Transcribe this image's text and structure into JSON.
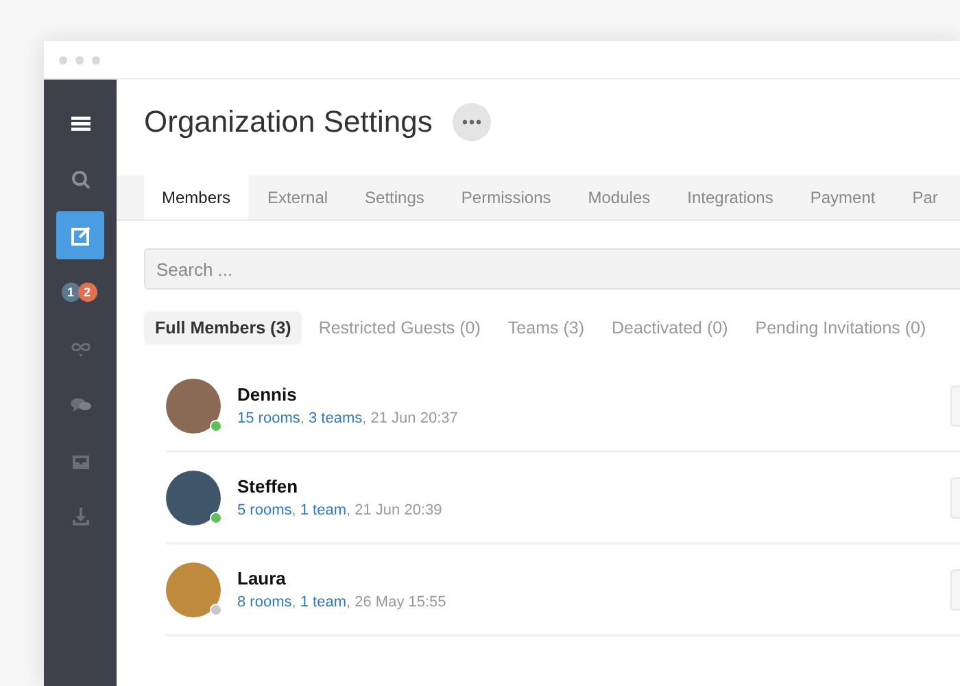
{
  "window": {
    "title": "Organization Settings"
  },
  "sidebar": {
    "items": [
      {
        "kind": "menu",
        "selected": false
      },
      {
        "kind": "search",
        "selected": false
      },
      {
        "kind": "compose",
        "selected": true
      },
      {
        "kind": "badges",
        "selected": false,
        "badges": [
          {
            "label": "1",
            "color": "#5b7a90"
          },
          {
            "label": "2",
            "color": "#e0714f"
          }
        ]
      },
      {
        "kind": "infinity",
        "selected": false
      },
      {
        "kind": "chat",
        "selected": false
      },
      {
        "kind": "inbox",
        "selected": false
      },
      {
        "kind": "download",
        "selected": false
      }
    ]
  },
  "tabs": [
    {
      "label": "Members",
      "selected": true
    },
    {
      "label": "External",
      "selected": false
    },
    {
      "label": "Settings",
      "selected": false
    },
    {
      "label": "Permissions",
      "selected": false
    },
    {
      "label": "Modules",
      "selected": false
    },
    {
      "label": "Integrations",
      "selected": false
    },
    {
      "label": "Payment",
      "selected": false
    },
    {
      "label": "Par",
      "selected": false
    }
  ],
  "search": {
    "placeholder": "Search ..."
  },
  "filters": [
    {
      "label": "Full Members (3)",
      "selected": true
    },
    {
      "label": "Restricted Guests (0)",
      "selected": false
    },
    {
      "label": "Teams (3)",
      "selected": false
    },
    {
      "label": "Deactivated (0)",
      "selected": false
    },
    {
      "label": "Pending Invitations (0)",
      "selected": false
    }
  ],
  "members": [
    {
      "name": "Dennis",
      "online": true,
      "details": [
        {
          "kind": "link",
          "text": "15 rooms"
        },
        {
          "kind": "text",
          "text": ", "
        },
        {
          "kind": "link",
          "text": "3 teams"
        },
        {
          "kind": "text",
          "text": ", "
        },
        {
          "kind": "time",
          "text": "21 Jun 20:37"
        }
      ]
    },
    {
      "name": "Steffen",
      "online": true,
      "details": [
        {
          "kind": "link",
          "text": "5 rooms"
        },
        {
          "kind": "text",
          "text": ", "
        },
        {
          "kind": "link",
          "text": "1 team"
        },
        {
          "kind": "text",
          "text": ", "
        },
        {
          "kind": "time",
          "text": "21 Jun 20:39"
        }
      ]
    },
    {
      "name": "Laura",
      "online": false,
      "details": [
        {
          "kind": "link",
          "text": "8 rooms"
        },
        {
          "kind": "text",
          "text": ", "
        },
        {
          "kind": "link",
          "text": "1 team"
        },
        {
          "kind": "text",
          "text": ", "
        },
        {
          "kind": "time",
          "text": "26 May 15:55"
        }
      ]
    }
  ]
}
